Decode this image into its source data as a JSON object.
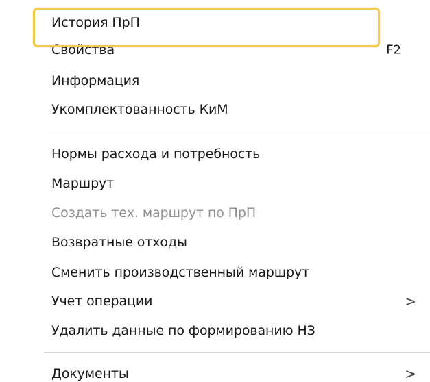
{
  "menu": {
    "highlight_color": "#f2cf4a",
    "items": [
      {
        "label": "История ПрП",
        "shortcut": "",
        "disabled": false
      },
      {
        "label": "Свойства",
        "shortcut": "F2",
        "disabled": false
      },
      {
        "label": "Информация",
        "shortcut": "",
        "disabled": false
      },
      {
        "label": "Укомплектованность КиМ",
        "shortcut": "",
        "disabled": false
      },
      {
        "label": "Нормы расхода и потребность",
        "shortcut": "",
        "disabled": false
      },
      {
        "label": "Маршрут",
        "shortcut": "",
        "disabled": false
      },
      {
        "label": "Создать тех. маршрут по ПрП",
        "shortcut": "",
        "disabled": true
      },
      {
        "label": "Возвратные отходы",
        "shortcut": "",
        "disabled": false
      },
      {
        "label": "Сменить производственный маршрут",
        "shortcut": "",
        "disabled": false
      },
      {
        "label": "Учет операции",
        "shortcut": "",
        "disabled": false,
        "submenu_arrow": ">"
      },
      {
        "label": "Удалить данные по формированию НЗ",
        "shortcut": "",
        "disabled": false
      },
      {
        "label": "Документы",
        "shortcut": "",
        "disabled": false,
        "submenu_arrow": ">"
      }
    ]
  }
}
